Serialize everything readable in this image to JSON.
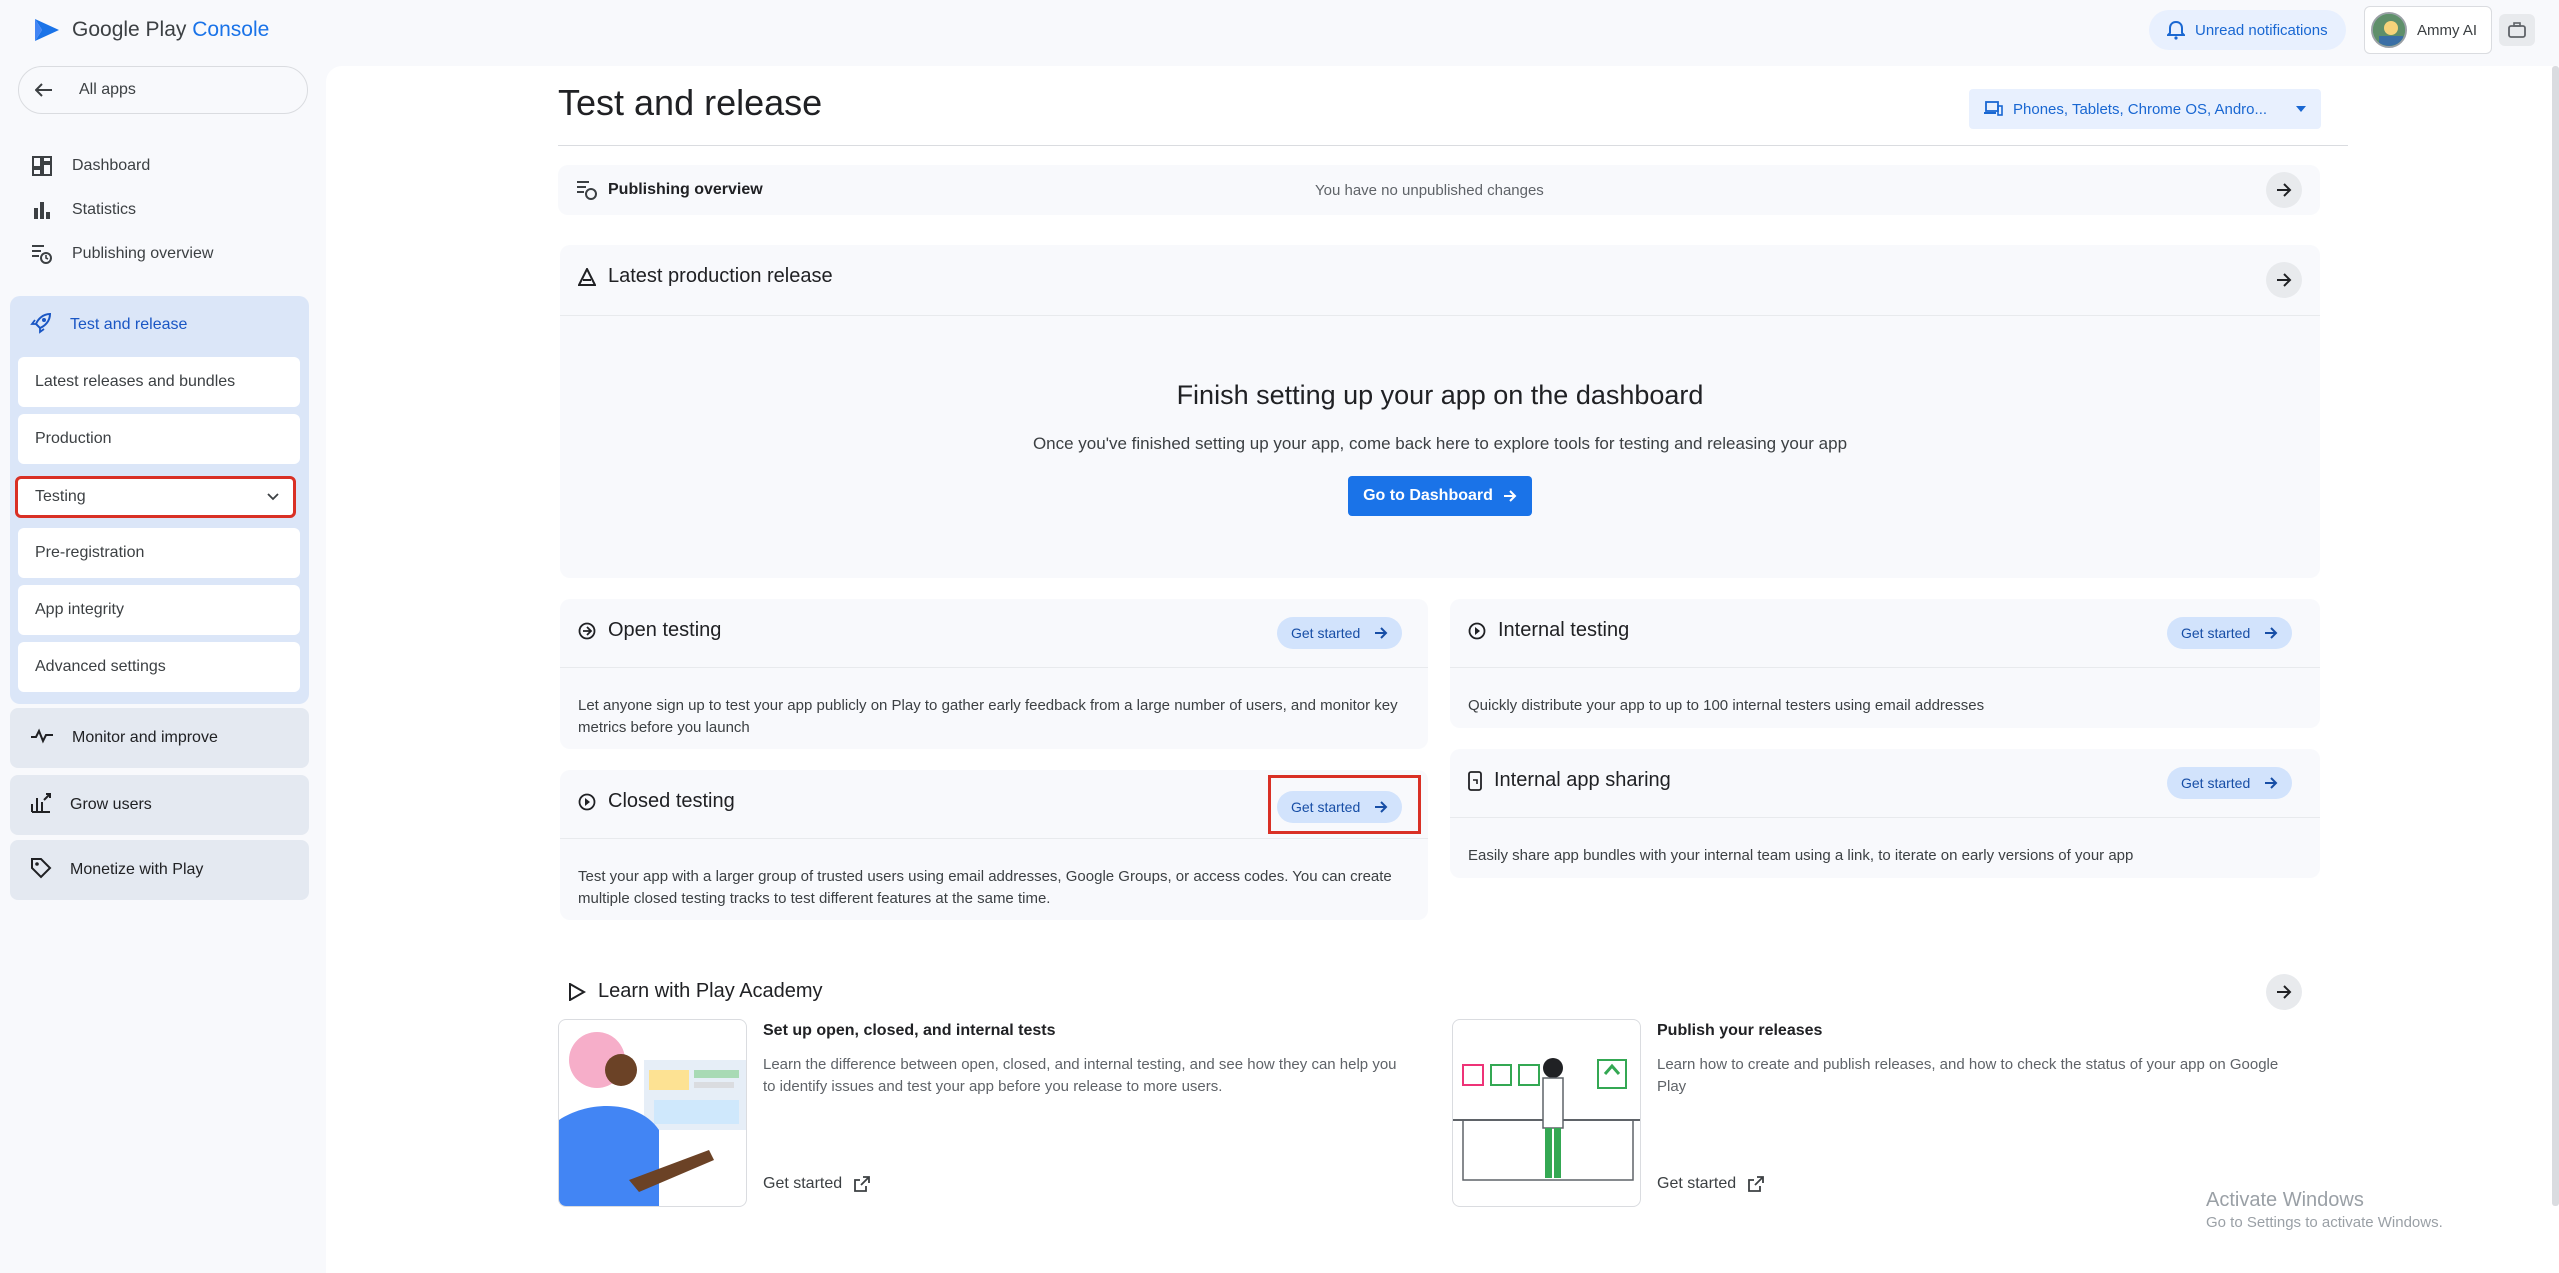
{
  "app": {
    "brand_prefix": "Google Play",
    "brand_suffix": "Console"
  },
  "header": {
    "notifications_label": "Unread notifications",
    "account_name": "Ammy AI"
  },
  "sidebar": {
    "all_apps": "All apps",
    "items": [
      {
        "label": "Dashboard",
        "icon": "dashboard-icon"
      },
      {
        "label": "Statistics",
        "icon": "bar-chart-icon"
      },
      {
        "label": "Publishing overview",
        "icon": "publishing-icon"
      }
    ],
    "test_release": {
      "label": "Test and release",
      "subitems": [
        "Latest releases and bundles",
        "Production",
        "Testing",
        "Pre-registration",
        "App integrity",
        "Advanced settings"
      ]
    },
    "groups": [
      {
        "label": "Monitor and improve",
        "icon": "monitor-icon"
      },
      {
        "label": "Grow users",
        "icon": "grow-icon"
      },
      {
        "label": "Monetize with Play",
        "icon": "tag-icon"
      }
    ]
  },
  "main": {
    "title": "Test and release",
    "device_filter": "Phones, Tablets, Chrome OS, Andro...",
    "publishing_overview": {
      "label": "Publishing overview",
      "status": "You have no unpublished changes"
    },
    "latest_production": {
      "label": "Latest production release",
      "finish_title": "Finish setting up your app on the dashboard",
      "finish_desc": "Once you've finished setting up your app, come back here to explore tools for testing and releasing your app",
      "button": "Go to Dashboard"
    },
    "testing_cards": {
      "open": {
        "title": "Open testing",
        "button": "Get started",
        "desc": "Let anyone sign up to test your app publicly on Play to gather early feedback from a large number of users, and monitor key metrics before you launch"
      },
      "closed": {
        "title": "Closed testing",
        "button": "Get started",
        "desc": "Test your app with a larger group of trusted users using email addresses, Google Groups, or access codes. You can create multiple closed testing tracks to test different features at the same time."
      },
      "internal": {
        "title": "Internal testing",
        "button": "Get started",
        "desc": "Quickly distribute your app to up to 100 internal testers using email addresses"
      },
      "sharing": {
        "title": "Internal app sharing",
        "button": "Get started",
        "desc": "Easily share app bundles with your internal team using a link, to iterate on early versions of your app"
      }
    },
    "learn": {
      "title": "Learn with Play Academy",
      "items": [
        {
          "title": "Set up open, closed, and internal tests",
          "desc": "Learn the difference between open, closed, and internal testing, and see how they can help you to identify issues and test your app before you release to more users.",
          "link": "Get started"
        },
        {
          "title": "Publish your releases",
          "desc": "Learn how to create and publish releases, and how to check the status of your app on Google Play",
          "link": "Get started"
        }
      ]
    }
  },
  "watermark": {
    "title": "Activate Windows",
    "subtitle": "Go to Settings to activate Windows."
  },
  "colors": {
    "accent": "#1a73e8",
    "highlight": "#d93025",
    "sidebar_active": "#dbe6f8"
  }
}
